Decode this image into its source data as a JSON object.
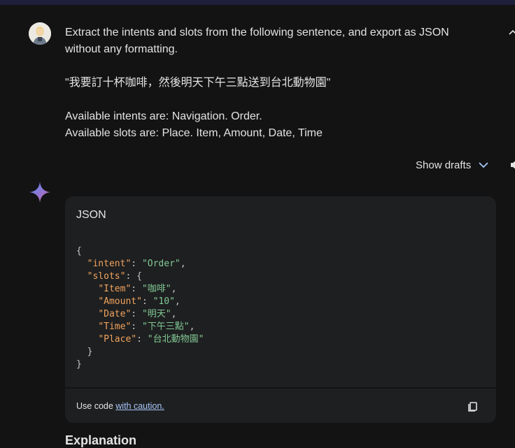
{
  "prompt": {
    "line1": "Extract the intents and slots from the following sentence, and export as JSON without any formatting.",
    "sentence": "\"我要訂十杯咖啡，然後明天下午三點送到台北動物園\"",
    "intents": "Available intents are: Navigation. Order.",
    "slots": "Available slots are: Place. Item, Amount, Date, Time"
  },
  "drafts": {
    "label": "Show drafts"
  },
  "code": {
    "language": "JSON",
    "lines": [
      {
        "indent": 0,
        "parts": [
          {
            "t": "p",
            "v": "{"
          }
        ]
      },
      {
        "indent": 1,
        "parts": [
          {
            "t": "k",
            "v": "\"intent\""
          },
          {
            "t": "p",
            "v": ": "
          },
          {
            "t": "s",
            "v": "\"Order\""
          },
          {
            "t": "p",
            "v": ","
          }
        ]
      },
      {
        "indent": 1,
        "parts": [
          {
            "t": "k",
            "v": "\"slots\""
          },
          {
            "t": "p",
            "v": ": {"
          }
        ]
      },
      {
        "indent": 2,
        "parts": [
          {
            "t": "k",
            "v": "\"Item\""
          },
          {
            "t": "p",
            "v": ": "
          },
          {
            "t": "s",
            "v": "\"咖啡\""
          },
          {
            "t": "p",
            "v": ","
          }
        ]
      },
      {
        "indent": 2,
        "parts": [
          {
            "t": "k",
            "v": "\"Amount\""
          },
          {
            "t": "p",
            "v": ": "
          },
          {
            "t": "s",
            "v": "\"10\""
          },
          {
            "t": "p",
            "v": ","
          }
        ]
      },
      {
        "indent": 2,
        "parts": [
          {
            "t": "k",
            "v": "\"Date\""
          },
          {
            "t": "p",
            "v": ": "
          },
          {
            "t": "s",
            "v": "\"明天\""
          },
          {
            "t": "p",
            "v": ","
          }
        ]
      },
      {
        "indent": 2,
        "parts": [
          {
            "t": "k",
            "v": "\"Time\""
          },
          {
            "t": "p",
            "v": ": "
          },
          {
            "t": "s",
            "v": "\"下午三點\""
          },
          {
            "t": "p",
            "v": ","
          }
        ]
      },
      {
        "indent": 2,
        "parts": [
          {
            "t": "k",
            "v": "\"Place\""
          },
          {
            "t": "p",
            "v": ": "
          },
          {
            "t": "s",
            "v": "\"台北動物園\""
          }
        ]
      },
      {
        "indent": 1,
        "parts": [
          {
            "t": "p",
            "v": "}"
          }
        ]
      },
      {
        "indent": 0,
        "parts": [
          {
            "t": "p",
            "v": "}"
          }
        ]
      }
    ],
    "caution_prefix": "Use code ",
    "caution_link": "with caution."
  },
  "explanation_heading": "Explanation",
  "colors": {
    "background": "#131314",
    "card": "#1e1f20",
    "key": "#f0a35e",
    "string": "#81c995",
    "link": "#a8c7fa"
  },
  "icons": [
    "user-avatar",
    "collapse-icon",
    "chevron-down-icon",
    "speaker-icon",
    "gemini-sparkle-icon",
    "copy-icon"
  ]
}
